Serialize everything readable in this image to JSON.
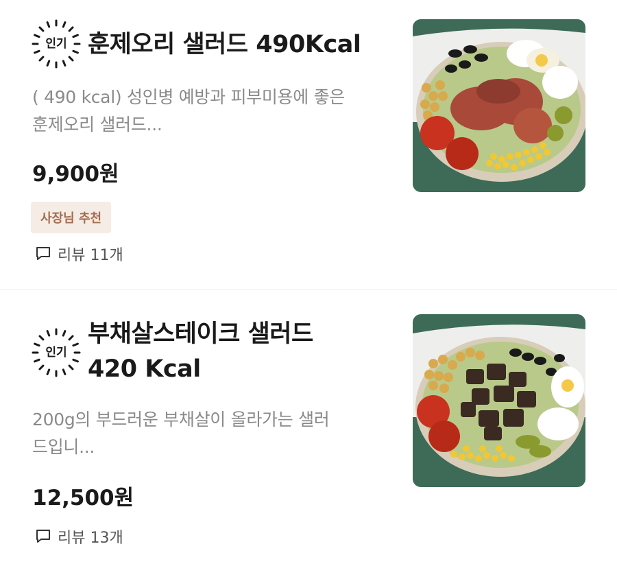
{
  "colors": {
    "badge_tag_bg": "#f5ece6",
    "badge_tag_text": "#a56d4d",
    "description": "#8a8a8a",
    "thumbnail_bg": "#3d6b58"
  },
  "items": [
    {
      "badge": "인기",
      "title_line1": "훈제오리 샐러드 490Kcal",
      "title_line2": "",
      "description_line1": "( 490 kcal) 성인병 예방과 피부미용에 좋은",
      "description_line2": "훈제오리 샐러드...",
      "price": "9,900원",
      "tag": "사장님 추천",
      "reviews": "리뷰 11개",
      "icon": "comment-icon"
    },
    {
      "badge": "인기",
      "title_line1": "부채살스테이크 샐러드",
      "title_line2": "420 Kcal",
      "description_line1": "200g의 부드러운 부채살이 올라가는 샐러",
      "description_line2": "드입니...",
      "price": "12,500원",
      "reviews": "리뷰 13개",
      "icon": "comment-icon"
    }
  ]
}
